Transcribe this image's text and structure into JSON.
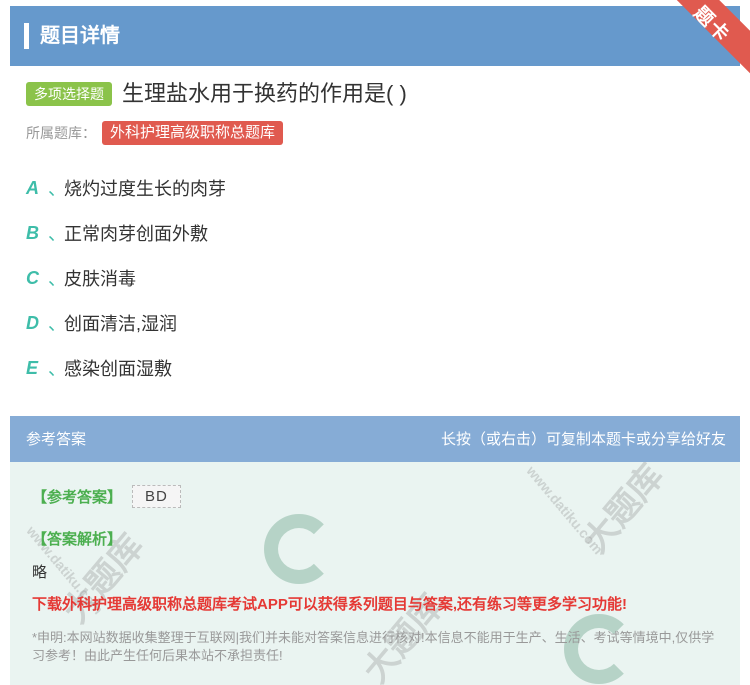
{
  "header": {
    "title": "题目详情",
    "ribbon": "题卡"
  },
  "question": {
    "type_badge": "多项选择题",
    "title": "生理盐水用于换药的作用是( )",
    "bank_label": "所属题库：",
    "bank_name": "外科护理高级职称总题库"
  },
  "options": [
    {
      "letter": "A",
      "sep": "、",
      "text": "烧灼过度生长的肉芽"
    },
    {
      "letter": "B",
      "sep": "、",
      "text": "正常肉芽创面外敷"
    },
    {
      "letter": "C",
      "sep": "、",
      "text": "皮肤消毒"
    },
    {
      "letter": "D",
      "sep": "、",
      "text": "创面清洁,湿润"
    },
    {
      "letter": "E",
      "sep": "、",
      "text": "感染创面湿敷"
    }
  ],
  "answer_bar": {
    "label": "参考答案",
    "hint": "长按（或右击）可复制本题卡或分享给好友"
  },
  "answer": {
    "key_label": "【参考答案】",
    "key_value": "BD",
    "analysis_label": "【答案解析】",
    "analysis_value": "略",
    "promo": "下载外科护理高级职称总题库考试APP可以获得系列题目与答案,还有练习等更多学习功能!",
    "disclaimer": "*申明:本网站数据收集整理于互联网|我们并未能对答案信息进行核对!本信息不能用于生产、生活、考试等情境中,仅供学习参考！由此产生任何后果本站不承担责任!"
  },
  "watermark": {
    "brand": "大题库",
    "domain": "www.datiku.com"
  },
  "colors": {
    "header": "#6699cc",
    "accent_green": "#8bc34a",
    "tag_red": "#e05a4f",
    "option_letter": "#3ebda9",
    "answer_bg": "#eaf4f1"
  }
}
